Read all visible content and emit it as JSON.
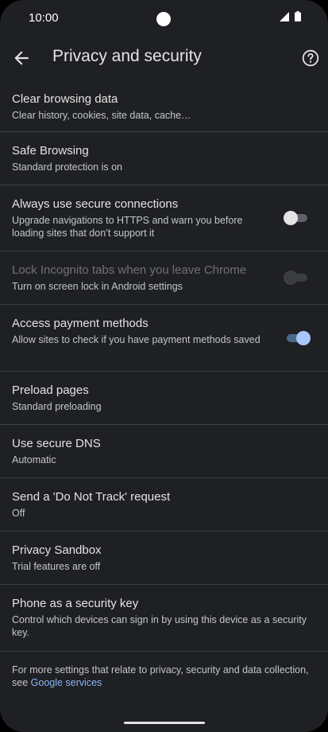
{
  "status_bar": {
    "time": "10:00"
  },
  "header": {
    "title": "Privacy and security",
    "back_icon": "arrow-back-icon",
    "help_icon": "help-circle-icon"
  },
  "settings": {
    "clear_browsing": {
      "title": "Clear browsing data",
      "subtitle": "Clear history, cookies, site data, cache…"
    },
    "safe_browsing": {
      "title": "Safe Browsing",
      "subtitle": "Standard protection is on"
    },
    "secure_connections": {
      "title": "Always use secure connections",
      "subtitle": "Upgrade navigations to HTTPS and warn you before loading sites that don’t support it",
      "toggle_on": false
    },
    "lock_incognito": {
      "title": "Lock Incognito tabs when you leave Chrome",
      "subtitle_link": "Turn on screen lock in Android settings",
      "toggle_on": false,
      "enabled": false
    },
    "payment_methods": {
      "title": "Access payment methods",
      "subtitle": "Allow sites to check if you have payment methods saved",
      "toggle_on": true
    },
    "preload": {
      "title": "Preload pages",
      "subtitle": "Standard preloading"
    },
    "secure_dns": {
      "title": "Use secure DNS",
      "subtitle": "Automatic"
    },
    "do_not_track": {
      "title": "Send a 'Do Not Track' request",
      "subtitle": "Off"
    },
    "privacy_sandbox": {
      "title": "Privacy Sandbox",
      "subtitle": "Trial features are off"
    },
    "security_key": {
      "title": "Phone as a security key",
      "subtitle": "Control which devices can sign in by using this device as a security key."
    }
  },
  "footer": {
    "text": "For more settings that relate to privacy, security and data collection, see ",
    "link": "Google services"
  },
  "colors": {
    "background": "#1f2023",
    "text": "#e3e3e3",
    "link": "#8ab4f8",
    "toggle_on": "#a8c7fa",
    "divider": "#3f4043"
  }
}
